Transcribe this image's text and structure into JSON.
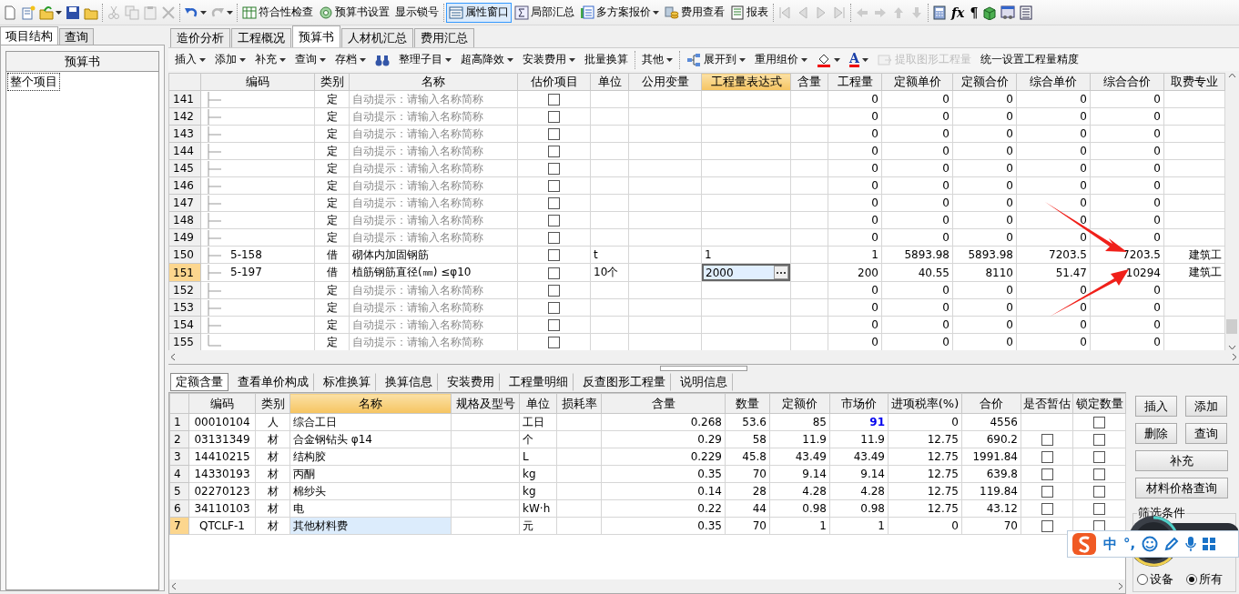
{
  "top_toolbar": [
    {
      "label": "符合性检查",
      "pressed": false
    },
    {
      "label": "预算书设置",
      "pressed": false
    },
    {
      "label": "显示锁号",
      "pressed": false
    },
    {
      "label": "属性窗口",
      "pressed": true
    },
    {
      "label": "局部汇总",
      "pressed": false
    },
    {
      "label": "多方案报价",
      "pressed": false
    },
    {
      "label": "费用查看",
      "pressed": false
    },
    {
      "label": "报表",
      "pressed": false
    }
  ],
  "glyph_buttons": [
    "fx",
    "¶"
  ],
  "left_panel": {
    "tabs": [
      {
        "label": "项目结构",
        "selected": true
      },
      {
        "label": "查询",
        "selected": false
      }
    ],
    "header": "预算书",
    "items": [
      {
        "label": "整个项目",
        "selected": true
      }
    ]
  },
  "main_tabs": [
    {
      "label": "造价分析",
      "selected": false
    },
    {
      "label": "工程概况",
      "selected": false
    },
    {
      "label": "预算书",
      "selected": true
    },
    {
      "label": "人材机汇总",
      "selected": false
    },
    {
      "label": "费用汇总",
      "selected": false
    }
  ],
  "sub_toolbar": [
    {
      "kind": "text",
      "label": "插入",
      "dropdown": true,
      "disabled": false
    },
    {
      "kind": "text",
      "label": "添加",
      "dropdown": true,
      "disabled": false
    },
    {
      "kind": "text",
      "label": "补充",
      "dropdown": true,
      "disabled": false
    },
    {
      "kind": "text",
      "label": "查询",
      "dropdown": true,
      "disabled": false
    },
    {
      "kind": "text",
      "label": "存档",
      "dropdown": true,
      "disabled": false
    },
    {
      "kind": "binoculars",
      "dropdown": false,
      "disabled": false
    },
    {
      "kind": "text",
      "label": "整理子目",
      "dropdown": true,
      "disabled": false
    },
    {
      "kind": "text",
      "label": "超高降效",
      "dropdown": true,
      "disabled": false
    },
    {
      "kind": "text",
      "label": "安装费用",
      "dropdown": true,
      "disabled": false
    },
    {
      "kind": "text",
      "label": "批量换算",
      "dropdown": false,
      "disabled": false
    },
    {
      "kind": "text",
      "label": "其他",
      "dropdown": true,
      "disabled": false
    },
    {
      "kind": "expand",
      "label": "展开到",
      "dropdown": true,
      "disabled": false
    },
    {
      "kind": "text",
      "label": "重用组价",
      "dropdown": true,
      "disabled": false
    },
    {
      "kind": "fill-color",
      "dropdown": true,
      "disabled": false
    },
    {
      "kind": "font-color",
      "label": "A",
      "dropdown": true,
      "disabled": false
    },
    {
      "kind": "extract",
      "label": "提取图形工程量",
      "dropdown": false,
      "disabled": true
    },
    {
      "kind": "text",
      "label": "统一设置工程量精度",
      "dropdown": false,
      "disabled": false
    }
  ],
  "main_table": {
    "columns": [
      {
        "label": "编码",
        "selected": false
      },
      {
        "label": "类别",
        "selected": false
      },
      {
        "label": "名称",
        "selected": false
      },
      {
        "label": "估价项目",
        "selected": false
      },
      {
        "label": "单位",
        "selected": false
      },
      {
        "label": "公用变量",
        "selected": false
      },
      {
        "label": "工程量表达式",
        "selected": true
      },
      {
        "label": "含量",
        "selected": false
      },
      {
        "label": "工程量",
        "selected": false
      },
      {
        "label": "定额单价",
        "selected": false
      },
      {
        "label": "定额合价",
        "selected": false
      },
      {
        "label": "综合单价",
        "selected": false
      },
      {
        "label": "综合合价",
        "selected": false
      },
      {
        "label": "取费专业",
        "selected": false
      }
    ],
    "rows": [
      {
        "num": "141",
        "type": "定",
        "name": "自动提示：请输入名称简称",
        "hint": true,
        "estimate": false,
        "qty": "0",
        "quota_price": "0",
        "quota_total": "0",
        "unit_price": "0",
        "total": "0",
        "selected": false,
        "editing": false
      },
      {
        "num": "142",
        "type": "定",
        "name": "自动提示：请输入名称简称",
        "hint": true,
        "estimate": false,
        "qty": "0",
        "quota_price": "0",
        "quota_total": "0",
        "unit_price": "0",
        "total": "0",
        "selected": false,
        "editing": false
      },
      {
        "num": "143",
        "type": "定",
        "name": "自动提示：请输入名称简称",
        "hint": true,
        "estimate": false,
        "qty": "0",
        "quota_price": "0",
        "quota_total": "0",
        "unit_price": "0",
        "total": "0",
        "selected": false,
        "editing": false
      },
      {
        "num": "144",
        "type": "定",
        "name": "自动提示：请输入名称简称",
        "hint": true,
        "estimate": false,
        "qty": "0",
        "quota_price": "0",
        "quota_total": "0",
        "unit_price": "0",
        "total": "0",
        "selected": false,
        "editing": false
      },
      {
        "num": "145",
        "type": "定",
        "name": "自动提示：请输入名称简称",
        "hint": true,
        "estimate": false,
        "qty": "0",
        "quota_price": "0",
        "quota_total": "0",
        "unit_price": "0",
        "total": "0",
        "selected": false,
        "editing": false
      },
      {
        "num": "146",
        "type": "定",
        "name": "自动提示：请输入名称简称",
        "hint": true,
        "estimate": false,
        "qty": "0",
        "quota_price": "0",
        "quota_total": "0",
        "unit_price": "0",
        "total": "0",
        "selected": false,
        "editing": false
      },
      {
        "num": "147",
        "type": "定",
        "name": "自动提示：请输入名称简称",
        "hint": true,
        "estimate": false,
        "qty": "0",
        "quota_price": "0",
        "quota_total": "0",
        "unit_price": "0",
        "total": "0",
        "selected": false,
        "editing": false
      },
      {
        "num": "148",
        "type": "定",
        "name": "自动提示：请输入名称简称",
        "hint": true,
        "estimate": false,
        "qty": "0",
        "quota_price": "0",
        "quota_total": "0",
        "unit_price": "0",
        "total": "0",
        "selected": false,
        "editing": false
      },
      {
        "num": "149",
        "type": "定",
        "name": "自动提示：请输入名称简称",
        "hint": true,
        "estimate": false,
        "qty": "0",
        "quota_price": "0",
        "quota_total": "0",
        "unit_price": "0",
        "total": "0",
        "selected": false,
        "editing": false
      },
      {
        "num": "150",
        "code": "5-158",
        "type": "借",
        "name": "砌体内加固钢筋",
        "hint": false,
        "estimate": false,
        "unit": "t",
        "expr": "1",
        "qty": "1",
        "quota_price": "5893.98",
        "quota_total": "5893.98",
        "unit_price": "7203.5",
        "total": "7203.5",
        "fee": "建筑工",
        "selected": false,
        "editing": false
      },
      {
        "num": "151",
        "code": "5-197",
        "type": "借",
        "name": "植筋钢筋直径(㎜) ≤φ10",
        "hint": false,
        "estimate": false,
        "unit": "10个",
        "expr": "2000",
        "qty": "200",
        "quota_price": "40.55",
        "quota_total": "8110",
        "unit_price": "51.47",
        "total": "10294",
        "fee": "建筑工",
        "selected": true,
        "editing": true
      },
      {
        "num": "152",
        "type": "定",
        "name": "自动提示：请输入名称简称",
        "hint": true,
        "estimate": false,
        "qty": "0",
        "quota_price": "0",
        "quota_total": "0",
        "unit_price": "0",
        "total": "0",
        "selected": false,
        "editing": false
      },
      {
        "num": "153",
        "type": "定",
        "name": "自动提示：请输入名称简称",
        "hint": true,
        "estimate": false,
        "qty": "0",
        "quota_price": "0",
        "quota_total": "0",
        "unit_price": "0",
        "total": "0",
        "selected": false,
        "editing": false
      },
      {
        "num": "154",
        "type": "定",
        "name": "自动提示：请输入名称简称",
        "hint": true,
        "estimate": false,
        "qty": "0",
        "quota_price": "0",
        "quota_total": "0",
        "unit_price": "0",
        "total": "0",
        "selected": false,
        "editing": false
      },
      {
        "num": "155",
        "type": "定",
        "name": "自动提示：请输入名称简称",
        "hint": true,
        "estimate": false,
        "qty": "0",
        "quota_price": "0",
        "quota_total": "0",
        "unit_price": "0",
        "total": "0",
        "selected": false,
        "editing": false
      }
    ]
  },
  "bottom_tabs": [
    {
      "label": "定额含量",
      "selected": true
    },
    {
      "label": "查看单价构成",
      "selected": false
    },
    {
      "label": "标准换算",
      "selected": false
    },
    {
      "label": "换算信息",
      "selected": false
    },
    {
      "label": "安装费用",
      "selected": false
    },
    {
      "label": "工程量明细",
      "selected": false
    },
    {
      "label": "反查图形工程量",
      "selected": false
    },
    {
      "label": "说明信息",
      "selected": false
    }
  ],
  "content_table": {
    "columns": [
      {
        "label": "编码",
        "selected": false
      },
      {
        "label": "类别",
        "selected": false
      },
      {
        "label": "名称",
        "selected": true
      },
      {
        "label": "规格及型号",
        "selected": false
      },
      {
        "label": "单位",
        "selected": false
      },
      {
        "label": "损耗率",
        "selected": false
      },
      {
        "label": "含量",
        "selected": false
      },
      {
        "label": "数量",
        "selected": false
      },
      {
        "label": "定额价",
        "selected": false
      },
      {
        "label": "市场价",
        "selected": false
      },
      {
        "label": "进项税率(%)",
        "selected": false
      },
      {
        "label": "合价",
        "selected": false
      },
      {
        "label": "是否暂估",
        "selected": false
      },
      {
        "label": "锁定数量",
        "selected": false
      }
    ],
    "rows": [
      {
        "num": "1",
        "code": "00010104",
        "type": "人",
        "name": "综合工日",
        "unit": "工日",
        "content": "0.268",
        "qty": "53.6",
        "quota": "85",
        "market": "91",
        "market_changed": true,
        "tax": "0",
        "total": "4556",
        "locked": false,
        "selected": false
      },
      {
        "num": "2",
        "code": "03131349",
        "type": "材",
        "name": "合金钢钻头 φ14",
        "unit": "个",
        "content": "0.29",
        "qty": "58",
        "quota": "11.9",
        "market": "11.9",
        "market_changed": false,
        "tax": "12.75",
        "total": "690.2",
        "estimate": false,
        "locked": false,
        "selected": false
      },
      {
        "num": "3",
        "code": "14410215",
        "type": "材",
        "name": "结构胶",
        "unit": "L",
        "content": "0.229",
        "qty": "45.8",
        "quota": "43.49",
        "market": "43.49",
        "market_changed": false,
        "tax": "12.75",
        "total": "1991.84",
        "estimate": false,
        "locked": false,
        "selected": false
      },
      {
        "num": "4",
        "code": "14330193",
        "type": "材",
        "name": "丙酮",
        "unit": "kg",
        "content": "0.35",
        "qty": "70",
        "quota": "9.14",
        "market": "9.14",
        "market_changed": false,
        "tax": "12.75",
        "total": "639.8",
        "estimate": false,
        "locked": false,
        "selected": false
      },
      {
        "num": "5",
        "code": "02270123",
        "type": "材",
        "name": "棉纱头",
        "unit": "kg",
        "content": "0.14",
        "qty": "28",
        "quota": "4.28",
        "market": "4.28",
        "market_changed": false,
        "tax": "12.75",
        "total": "119.84",
        "estimate": false,
        "locked": false,
        "selected": false
      },
      {
        "num": "6",
        "code": "34110103",
        "type": "材",
        "name": "电",
        "unit": "kW·h",
        "content": "0.22",
        "qty": "44",
        "quota": "0.98",
        "market": "0.98",
        "market_changed": false,
        "tax": "12.75",
        "total": "43.12",
        "estimate": false,
        "locked": false,
        "selected": false
      },
      {
        "num": "7",
        "code": "QTCLF-1",
        "type": "材",
        "name": "其他材料费",
        "unit": "元",
        "content": "0.35",
        "qty": "70",
        "quota": "1",
        "market": "1",
        "market_changed": false,
        "tax": "0",
        "total": "70",
        "estimate": false,
        "locked": false,
        "selected": true
      }
    ]
  },
  "side_buttons": [
    {
      "label": "插入",
      "wide": false
    },
    {
      "label": "添加",
      "wide": false
    },
    {
      "label": "删除",
      "wide": false
    },
    {
      "label": "查询",
      "wide": false
    },
    {
      "label": "补充",
      "wide": true
    },
    {
      "label": "材料价格查询",
      "wide": true
    }
  ],
  "filter": {
    "title": "筛选条件",
    "options": [
      {
        "label": "设备",
        "selected": false
      },
      {
        "label": "所有",
        "selected": true
      }
    ]
  },
  "ime_bar": {
    "mode": "中",
    "punctuation": "°,"
  }
}
